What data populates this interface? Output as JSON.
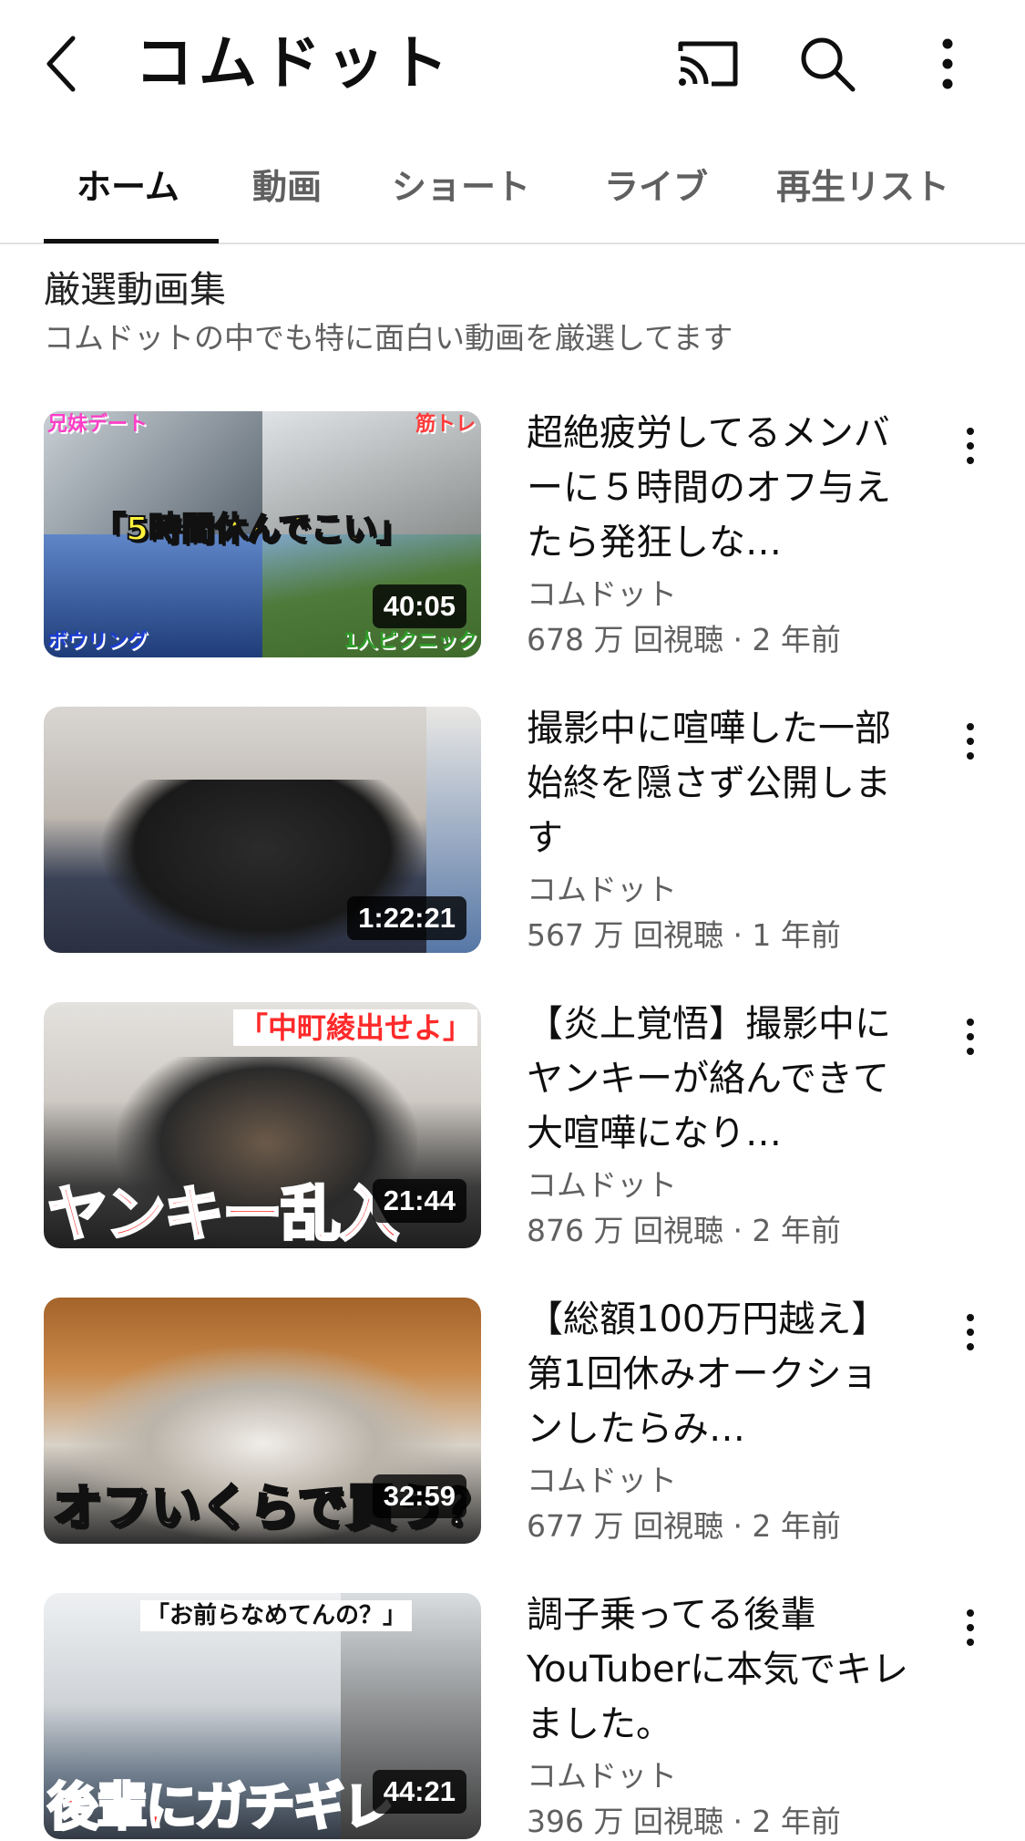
{
  "header": {
    "title": "コムドット",
    "back_icon": "back-arrow-icon",
    "cast_icon": "cast-icon",
    "search_icon": "search-icon",
    "more_icon": "more-vert-icon"
  },
  "tabs": [
    {
      "label": "ホーム",
      "active": true
    },
    {
      "label": "動画"
    },
    {
      "label": "ショート"
    },
    {
      "label": "ライブ"
    },
    {
      "label": "再生リスト"
    }
  ],
  "section": {
    "title": "厳選動画集",
    "subtitle": "コムドットの中でも特に面白い動画を厳選してます"
  },
  "videos": [
    {
      "title": "超絶疲労してるメンバーに５時間のオフ与えたら発狂しな…",
      "channel": "コムドット",
      "meta": "678 万 回視聴 · 2 年前",
      "duration": "40:05",
      "thumb_text": [
        "兄妹デート",
        "筋トレ",
        "「5時間休んでこい」",
        "ボウリング",
        "1人ピクニック"
      ]
    },
    {
      "title": "撮影中に喧嘩した一部始終を隠さず公開します",
      "channel": "コムドット",
      "meta": "567 万 回視聴 · 1 年前",
      "duration": "1:22:21",
      "thumb_text": []
    },
    {
      "title": "【炎上覚悟】撮影中にヤンキーが絡んできて大喧嘩になり…",
      "channel": "コムドット",
      "meta": "876 万 回視聴 · 2 年前",
      "duration": "21:44",
      "thumb_text": [
        "「中町綾出せよ」",
        "ヤンキー乱入"
      ]
    },
    {
      "title": "【総額100万円越え】第1回休みオークションしたらみ…",
      "channel": "コムドット",
      "meta": "677 万 回視聴 · 2 年前",
      "duration": "32:59",
      "thumb_text": [
        "オフいくらで買う？"
      ]
    },
    {
      "title": "調子乗ってる後輩YouTuberに本気でキレました。",
      "channel": "コムドット",
      "meta": "396 万 回視聴 · 2 年前",
      "duration": "44:21",
      "thumb_text": [
        "「お前らなめてんの？」",
        "後輩にガチギレ"
      ]
    }
  ]
}
